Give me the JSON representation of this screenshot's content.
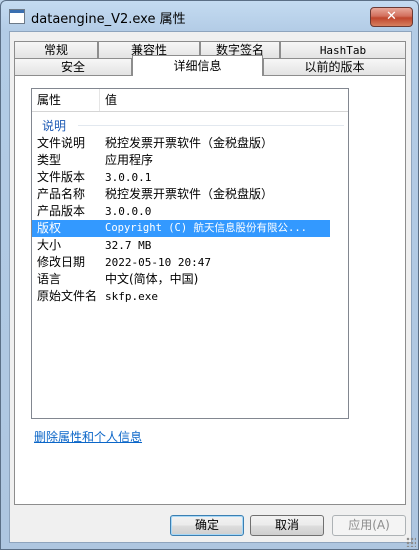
{
  "window": {
    "title": "dataengine_V2.exe 属性",
    "close_label": "✕"
  },
  "tabs_row1": [
    "常规",
    "兼容性",
    "数字签名",
    "HashTab"
  ],
  "tabs_row2": [
    "安全",
    "详细信息",
    "以前的版本"
  ],
  "active_tab": "详细信息",
  "details": {
    "columns": [
      "属性",
      "值"
    ],
    "group": "说明",
    "rows": [
      {
        "key": "文件说明",
        "value": "税控发票开票软件（金税盘版）"
      },
      {
        "key": "类型",
        "value": "应用程序"
      },
      {
        "key": "文件版本",
        "value": "3.0.0.1"
      },
      {
        "key": "产品名称",
        "value": "税控发票开票软件（金税盘版）"
      },
      {
        "key": "产品版本",
        "value": "3.0.0.0"
      },
      {
        "key": "版权",
        "value": "Copyright (C) 航天信息股份有限公..."
      },
      {
        "key": "大小",
        "value": "32.7 MB"
      },
      {
        "key": "修改日期",
        "value": "2022-05-10 20:47"
      },
      {
        "key": "语言",
        "value": "中文(简体，中国)"
      },
      {
        "key": "原始文件名",
        "value": "skfp.exe"
      }
    ],
    "selected_row": "版权"
  },
  "remove_link": "删除属性和个人信息",
  "buttons": {
    "ok": "确定",
    "cancel": "取消",
    "apply": "应用(A)"
  }
}
